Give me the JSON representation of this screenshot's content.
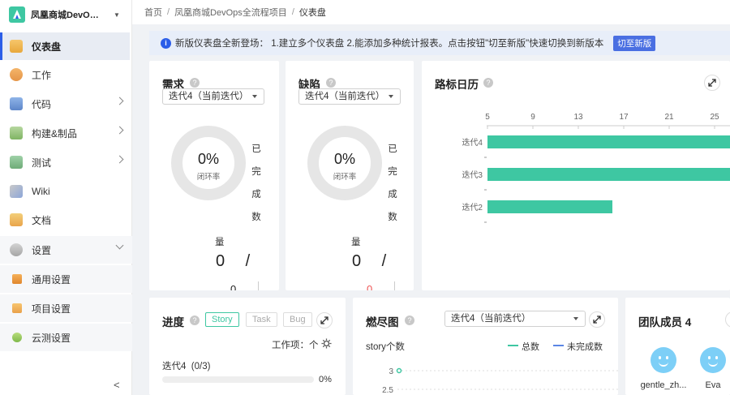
{
  "project": {
    "name": "凤凰商城DevOps全流程项目"
  },
  "nav": {
    "items": [
      {
        "label": "仪表盘"
      },
      {
        "label": "工作"
      },
      {
        "label": "代码"
      },
      {
        "label": "构建&制品"
      },
      {
        "label": "测试"
      },
      {
        "label": "Wiki"
      },
      {
        "label": "文档"
      },
      {
        "label": "设置"
      }
    ],
    "sub": [
      {
        "label": "通用设置"
      },
      {
        "label": "项目设置"
      },
      {
        "label": "云测设置"
      }
    ]
  },
  "breadcrumb": {
    "home": "首页",
    "project": "凤凰商城DevOps全流程项目",
    "current": "仪表盘"
  },
  "notice": {
    "text": "新版仪表盘全新登场：  1.建立多个仪表盘 2.能添加多种统计报表。点击按钮\"切至新版\"快速切换到新版本",
    "button": "切至新版"
  },
  "req_card": {
    "title": "需求",
    "select": "迭代4（当前迭代）",
    "pct": "0%",
    "sub": "闭环率",
    "vert": [
      "已",
      "完",
      "成",
      "数"
    ],
    "liang": "量",
    "clip": "0 /",
    "tail": "0"
  },
  "bug_card": {
    "title": "缺陷",
    "select": "迭代4（当前迭代）",
    "pct": "0%",
    "sub": "闭环率",
    "vert": [
      "已",
      "完",
      "成",
      "数"
    ],
    "liang": "量",
    "clip": "0 /",
    "tail": "0"
  },
  "milestone": {
    "title": "路标日历",
    "ticks": [
      "5",
      "9",
      "13",
      "17",
      "21",
      "25"
    ],
    "rows": [
      "迭代4",
      "迭代3",
      "迭代2"
    ]
  },
  "progress": {
    "title": "进度",
    "tabs": [
      "Story",
      "Task",
      "Bug"
    ],
    "work_label": "工作项：个",
    "item": "迭代4",
    "item_count": "(0/3)",
    "item_pct": "0%"
  },
  "burndown": {
    "title": "燃尽图",
    "select": "迭代4（当前迭代）",
    "ylabel": "story个数",
    "legend": [
      "总数",
      "未完成数"
    ],
    "colors": {
      "total": "#3ec7a2",
      "undone": "#5b86e5"
    }
  },
  "members": {
    "title": "团队成员 4",
    "people": [
      {
        "name": "gentle_zh..."
      },
      {
        "name": "Eva"
      }
    ]
  },
  "chart_data": {
    "type": "line",
    "title": "燃尽图",
    "ylabel": "story个数",
    "yticks": [
      "3",
      "2.5"
    ],
    "series": [
      {
        "name": "总数",
        "values": [
          3
        ]
      },
      {
        "name": "未完成数",
        "values": []
      }
    ]
  }
}
